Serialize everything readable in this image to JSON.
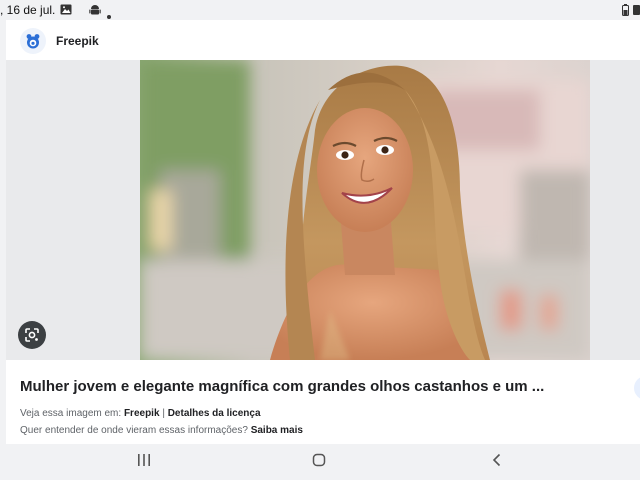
{
  "status_bar": {
    "time": ", 16 de jul.",
    "icons": [
      "gallery-icon",
      "android-icon",
      "dot-icon",
      "battery-saver-icon"
    ]
  },
  "result": {
    "source_name": "Freepik",
    "title": "Mulher jovem e elegante magnífica com grandes olhos castanhos e um ...",
    "see_on_prefix": "Veja essa imagem em:",
    "see_on_source": "Freepik",
    "separator": "|",
    "license_link": "Detalhes da licença",
    "question": "Quer entender de onde vieram essas informações?",
    "learn_more": "Saiba mais"
  },
  "nav_bar": {
    "buttons": [
      "recent-apps-icon",
      "home-icon",
      "back-icon"
    ]
  },
  "colors": {
    "background": "#f1f2f4",
    "card": "#ffffff",
    "text_primary": "#202124",
    "text_secondary": "#5f6368"
  }
}
